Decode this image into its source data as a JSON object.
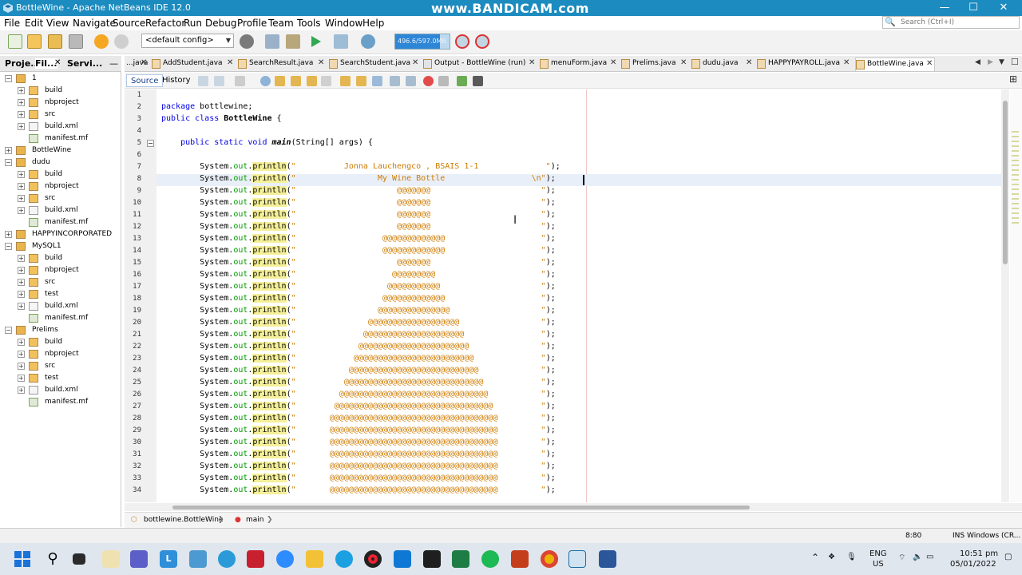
{
  "window": {
    "title": "BottleWine - Apache NetBeans IDE 12.0",
    "watermark": "www.BANDICAM.com",
    "minimize": "—",
    "maximize": "☐",
    "close": "✕"
  },
  "menu": [
    "File",
    "Edit",
    "View",
    "Navigate",
    "Source",
    "Refactor",
    "Run",
    "Debug",
    "Profile",
    "Team",
    "Tools",
    "Window",
    "Help"
  ],
  "search": {
    "placeholder": "Search (Ctrl+I)"
  },
  "toolbar": {
    "config": "<default config>",
    "memory": "496.6/597.0MB",
    "memory_fraction": 0.83
  },
  "left_panel": {
    "tabs": [
      "Proje...",
      "Fil...",
      "Servi..."
    ],
    "tree": [
      {
        "label": "1",
        "level": 0,
        "exp": "−",
        "icon": "project-icon"
      },
      {
        "label": "build",
        "level": 1,
        "exp": "+",
        "icon": "folder-icon"
      },
      {
        "label": "nbproject",
        "level": 1,
        "exp": "+",
        "icon": "folder-icon"
      },
      {
        "label": "src",
        "level": 1,
        "exp": "+",
        "icon": "folder-icon"
      },
      {
        "label": "build.xml",
        "level": 1,
        "exp": "+",
        "icon": "xml-file-icon"
      },
      {
        "label": "manifest.mf",
        "level": 1,
        "exp": "",
        "icon": "file-icon"
      },
      {
        "label": "BottleWine",
        "level": 0,
        "exp": "+",
        "icon": "project-icon"
      },
      {
        "label": "dudu",
        "level": 0,
        "exp": "−",
        "icon": "project-icon"
      },
      {
        "label": "build",
        "level": 1,
        "exp": "+",
        "icon": "folder-icon"
      },
      {
        "label": "nbproject",
        "level": 1,
        "exp": "+",
        "icon": "folder-icon"
      },
      {
        "label": "src",
        "level": 1,
        "exp": "+",
        "icon": "folder-icon"
      },
      {
        "label": "build.xml",
        "level": 1,
        "exp": "+",
        "icon": "xml-file-icon"
      },
      {
        "label": "manifest.mf",
        "level": 1,
        "exp": "",
        "icon": "file-icon"
      },
      {
        "label": "HAPPYINCORPORATED",
        "level": 0,
        "exp": "+",
        "icon": "project-icon"
      },
      {
        "label": "MySQL1",
        "level": 0,
        "exp": "−",
        "icon": "project-icon"
      },
      {
        "label": "build",
        "level": 1,
        "exp": "+",
        "icon": "folder-icon"
      },
      {
        "label": "nbproject",
        "level": 1,
        "exp": "+",
        "icon": "folder-icon"
      },
      {
        "label": "src",
        "level": 1,
        "exp": "+",
        "icon": "folder-icon"
      },
      {
        "label": "test",
        "level": 1,
        "exp": "+",
        "icon": "folder-icon"
      },
      {
        "label": "build.xml",
        "level": 1,
        "exp": "+",
        "icon": "xml-file-icon"
      },
      {
        "label": "manifest.mf",
        "level": 1,
        "exp": "",
        "icon": "file-icon"
      },
      {
        "label": "Prelims",
        "level": 0,
        "exp": "−",
        "icon": "project-icon"
      },
      {
        "label": "build",
        "level": 1,
        "exp": "+",
        "icon": "folder-icon"
      },
      {
        "label": "nbproject",
        "level": 1,
        "exp": "+",
        "icon": "folder-icon"
      },
      {
        "label": "src",
        "level": 1,
        "exp": "+",
        "icon": "folder-icon"
      },
      {
        "label": "test",
        "level": 1,
        "exp": "+",
        "icon": "folder-icon"
      },
      {
        "label": "build.xml",
        "level": 1,
        "exp": "+",
        "icon": "xml-file-icon"
      },
      {
        "label": "manifest.mf",
        "level": 1,
        "exp": "",
        "icon": "file-icon"
      }
    ]
  },
  "editor_tabs": [
    {
      "label": "...java",
      "active": false
    },
    {
      "label": "AddStudent.java",
      "active": false
    },
    {
      "label": "SearchResult.java",
      "active": false
    },
    {
      "label": "SearchStudent.java",
      "active": false
    },
    {
      "label": "Output - BottleWine (run)",
      "active": false
    },
    {
      "label": "menuForm.java",
      "active": false
    },
    {
      "label": "Prelims.java",
      "active": false
    },
    {
      "label": "dudu.java",
      "active": false
    },
    {
      "label": "HAPPYPAYROLL.java",
      "active": false
    },
    {
      "label": "BottleWine.java",
      "active": true
    }
  ],
  "editor_toolbar": {
    "source": "Source",
    "history": "History"
  },
  "code": {
    "package_line": "package bottlewine;",
    "class_name": "BottleWine",
    "method_name": "main",
    "art_lines": [
      "\"          Jonna Lauchengco , BSAIS 1-1              \");",
      "\"                 My Wine Bottle                  \\n\");",
      "\"                     @@@@@@@                       \");",
      "\"                     @@@@@@@                       \");",
      "\"                     @@@@@@@                       \");",
      "\"                     @@@@@@@                       \");",
      "\"                  @@@@@@@@@@@@@                    \");",
      "\"                  @@@@@@@@@@@@@                    \");",
      "\"                     @@@@@@@                       \");",
      "\"                    @@@@@@@@@                      \");",
      "\"                   @@@@@@@@@@@                     \");",
      "\"                  @@@@@@@@@@@@@                    \");",
      "\"                 @@@@@@@@@@@@@@@                   \");",
      "\"               @@@@@@@@@@@@@@@@@@@                 \");",
      "\"              @@@@@@@@@@@@@@@@@@@@@                \");",
      "\"             @@@@@@@@@@@@@@@@@@@@@@@               \");",
      "\"            @@@@@@@@@@@@@@@@@@@@@@@@@              \");",
      "\"           @@@@@@@@@@@@@@@@@@@@@@@@@@@             \");",
      "\"          @@@@@@@@@@@@@@@@@@@@@@@@@@@@@            \");",
      "\"         @@@@@@@@@@@@@@@@@@@@@@@@@@@@@@@           \");",
      "\"        @@@@@@@@@@@@@@@@@@@@@@@@@@@@@@@@@          \");",
      "\"       @@@@@@@@@@@@@@@@@@@@@@@@@@@@@@@@@@@         \");",
      "\"       @@@@@@@@@@@@@@@@@@@@@@@@@@@@@@@@@@@         \");",
      "\"       @@@@@@@@@@@@@@@@@@@@@@@@@@@@@@@@@@@         \");",
      "\"       @@@@@@@@@@@@@@@@@@@@@@@@@@@@@@@@@@@         \");",
      "\"       @@@@@@@@@@@@@@@@@@@@@@@@@@@@@@@@@@@         \");",
      "\"       @@@@@@@@@@@@@@@@@@@@@@@@@@@@@@@@@@@         \");",
      "\"       @@@@@@@@@@@@@@@@@@@@@@@@@@@@@@@@@@@         \");"
    ]
  },
  "breadcrumb": [
    "bottlewine.BottleWine",
    "main"
  ],
  "status": {
    "position": "8:80",
    "ins": "INS",
    "line_endings": "Windows (CR..."
  },
  "taskbar": {
    "lang": "ENG",
    "region": "US",
    "time": "10:51 pm",
    "date": "05/01/2022"
  }
}
